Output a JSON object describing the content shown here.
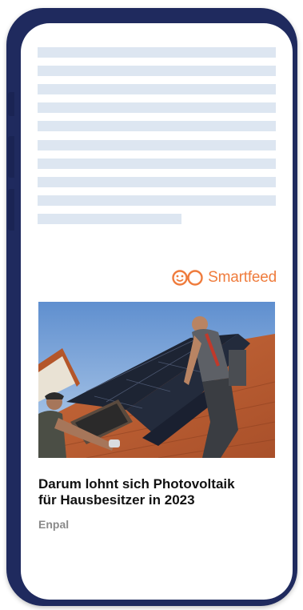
{
  "ad": {
    "brand_name": "Smartfeed",
    "headline_line1": "Darum lohnt sich Photovoltaik",
    "headline_line2": "für Hausbesitzer in 2023",
    "source": "Enpal"
  },
  "colors": {
    "phone_frame": "#1f2a5e",
    "placeholder": "#dde6f1",
    "brand": "#ef7c3d",
    "headline": "#111111",
    "source": "#8a8a8a"
  },
  "icons": {
    "brand_logo": "smartfeed-infinity-icon",
    "hero": "solar-panel-roof-photo"
  },
  "placeholder_lines": 10
}
